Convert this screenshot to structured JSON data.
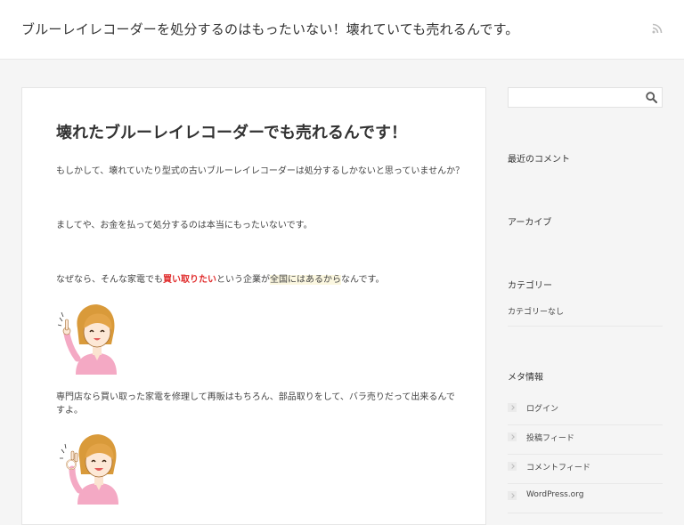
{
  "header": {
    "site_title": "ブルーレイレコーダーを処分するのはもったいない！壊れていても売れるんです。",
    "rss_icon": "rss-icon"
  },
  "post": {
    "title": "壊れたブルーレイレコーダーでも売れるんです！",
    "p1": "もしかして、壊れていたり型式の古いブルーレイレコーダーは処分するしかないと思っていませんか？",
    "p2": "ましてや、お金を払って処分するのは本当にもったいないです。",
    "p3_before": "なぜなら、そんな家電でも",
    "p3_red": "買い取りたい",
    "p3_mid": "という企業が",
    "p3_hl": "全国にはあるから",
    "p3_after": "なんです。",
    "p4": "専門店なら買い取った家電を修理して再販はもちろん、部品取りをして、バラ売りだって出来るんですよ。",
    "accent_red": "#e02b2b"
  },
  "sidebar": {
    "search_placeholder": "",
    "search_icon": "search-icon",
    "recent_comments_title": "最近のコメント",
    "archive_title": "アーカイブ",
    "category_title": "カテゴリー",
    "category_empty": "カテゴリーなし",
    "meta_title": "メタ情報",
    "meta_items": [
      "ログイン",
      "投稿フィード",
      "コメントフィード",
      "WordPress.org"
    ]
  }
}
